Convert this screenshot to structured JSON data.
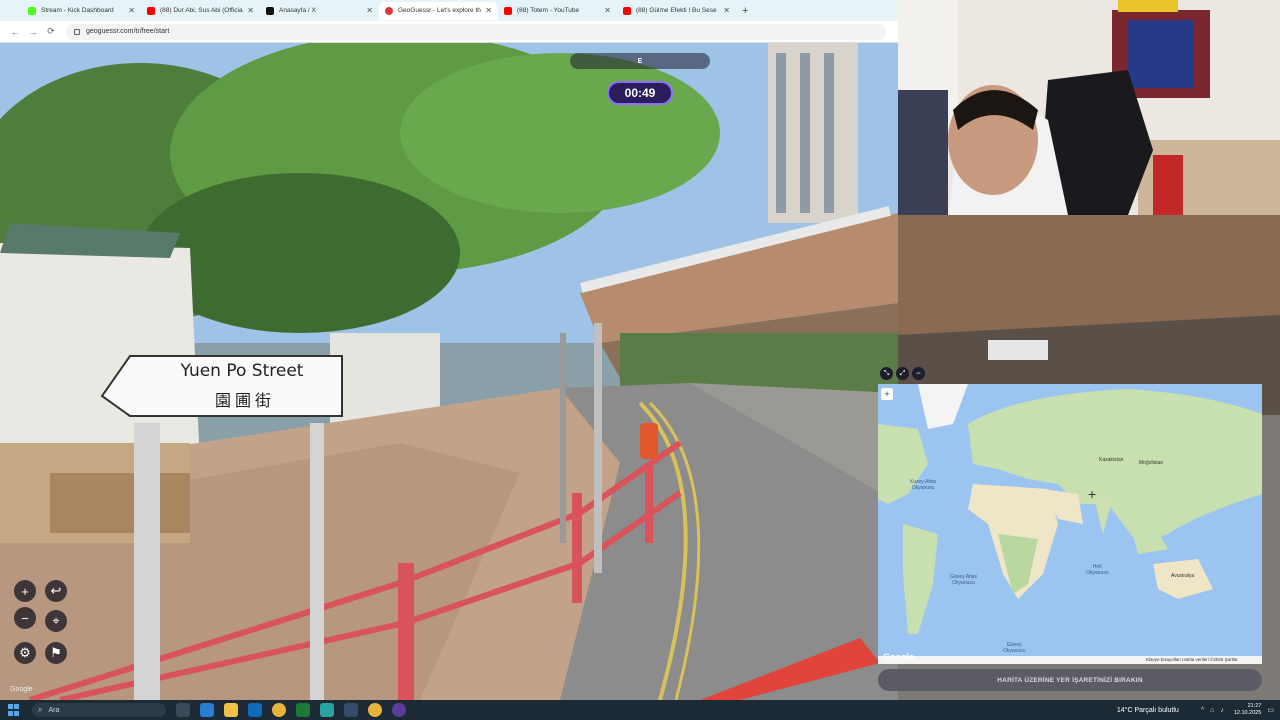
{
  "browser": {
    "tabs": [
      {
        "title": "Stream - Kick Dashboard",
        "color": "#53fc18",
        "active": false
      },
      {
        "title": "(88) Dur Abi, Sus Abi (Official V",
        "color": "#ff0000",
        "active": false
      },
      {
        "title": "Anasayfa / X",
        "color": "#111111",
        "active": false
      },
      {
        "title": "GeoGuessr - Let's explore the w",
        "color": "#d83a3a",
        "active": true
      },
      {
        "title": "(88) Totem - YouTube",
        "color": "#ff0000",
        "active": false
      },
      {
        "title": "(88) Gülme Efekti I Bu Sese İnan",
        "color": "#ff0000",
        "active": false
      }
    ],
    "new_tab": "+",
    "back": "←",
    "forward": "→",
    "reload": "⟳",
    "url": "geoguessr.com/tr/free/start"
  },
  "game": {
    "compass_letter": "E",
    "timer": "00:49",
    "street_sign_en": "Yuen Po Street",
    "street_sign_zh": "園圃街",
    "controls": {
      "zoom_in": "+",
      "zoom_out": "−",
      "undo": "↩",
      "return_start": "⌖",
      "settings": "⚙",
      "flag": "⚑"
    },
    "google_logo": "Google"
  },
  "map": {
    "tools": [
      "⤡",
      "⤢",
      "⇔"
    ],
    "zoom_in": "+",
    "labels": {
      "kazakistan": "Kazakistan",
      "mogolistan": "Moğolistan",
      "kuzey_atlas": "Kuzey Atlas\nOkyanusu",
      "hint": "Hint\nOkyanusu",
      "guney_atlas": "Güney Atlas\nOkyanusu",
      "guney": "Güney\nOkyanusu",
      "avustralya": "Avustralya"
    },
    "google": "Google",
    "attribution": "Klavye kısayolları  Harita verileri ©2025  Şartlar",
    "guess_button": "HARİTA ÜZERİNE YER İŞARETİNİZİ BIRAKIN"
  },
  "taskbar": {
    "search_placeholder": "Ara",
    "weather": "14°C  Parçalı bulutlu",
    "time": "21:27",
    "date": "12.10.2025"
  }
}
